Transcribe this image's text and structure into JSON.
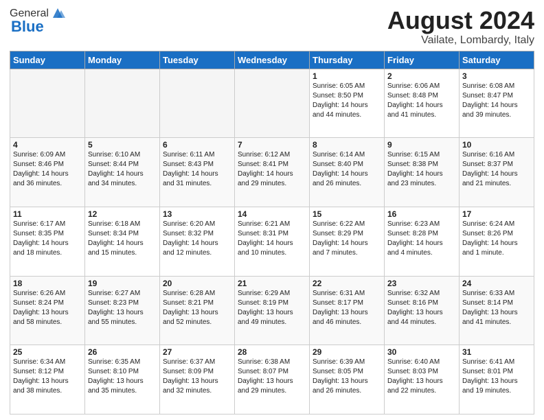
{
  "header": {
    "logo_general": "General",
    "logo_blue": "Blue",
    "month_year": "August 2024",
    "location": "Vailate, Lombardy, Italy"
  },
  "days_of_week": [
    "Sunday",
    "Monday",
    "Tuesday",
    "Wednesday",
    "Thursday",
    "Friday",
    "Saturday"
  ],
  "weeks": [
    [
      {
        "day": "",
        "info": ""
      },
      {
        "day": "",
        "info": ""
      },
      {
        "day": "",
        "info": ""
      },
      {
        "day": "",
        "info": ""
      },
      {
        "day": "1",
        "info": "Sunrise: 6:05 AM\nSunset: 8:50 PM\nDaylight: 14 hours\nand 44 minutes."
      },
      {
        "day": "2",
        "info": "Sunrise: 6:06 AM\nSunset: 8:48 PM\nDaylight: 14 hours\nand 41 minutes."
      },
      {
        "day": "3",
        "info": "Sunrise: 6:08 AM\nSunset: 8:47 PM\nDaylight: 14 hours\nand 39 minutes."
      }
    ],
    [
      {
        "day": "4",
        "info": "Sunrise: 6:09 AM\nSunset: 8:46 PM\nDaylight: 14 hours\nand 36 minutes."
      },
      {
        "day": "5",
        "info": "Sunrise: 6:10 AM\nSunset: 8:44 PM\nDaylight: 14 hours\nand 34 minutes."
      },
      {
        "day": "6",
        "info": "Sunrise: 6:11 AM\nSunset: 8:43 PM\nDaylight: 14 hours\nand 31 minutes."
      },
      {
        "day": "7",
        "info": "Sunrise: 6:12 AM\nSunset: 8:41 PM\nDaylight: 14 hours\nand 29 minutes."
      },
      {
        "day": "8",
        "info": "Sunrise: 6:14 AM\nSunset: 8:40 PM\nDaylight: 14 hours\nand 26 minutes."
      },
      {
        "day": "9",
        "info": "Sunrise: 6:15 AM\nSunset: 8:38 PM\nDaylight: 14 hours\nand 23 minutes."
      },
      {
        "day": "10",
        "info": "Sunrise: 6:16 AM\nSunset: 8:37 PM\nDaylight: 14 hours\nand 21 minutes."
      }
    ],
    [
      {
        "day": "11",
        "info": "Sunrise: 6:17 AM\nSunset: 8:35 PM\nDaylight: 14 hours\nand 18 minutes."
      },
      {
        "day": "12",
        "info": "Sunrise: 6:18 AM\nSunset: 8:34 PM\nDaylight: 14 hours\nand 15 minutes."
      },
      {
        "day": "13",
        "info": "Sunrise: 6:20 AM\nSunset: 8:32 PM\nDaylight: 14 hours\nand 12 minutes."
      },
      {
        "day": "14",
        "info": "Sunrise: 6:21 AM\nSunset: 8:31 PM\nDaylight: 14 hours\nand 10 minutes."
      },
      {
        "day": "15",
        "info": "Sunrise: 6:22 AM\nSunset: 8:29 PM\nDaylight: 14 hours\nand 7 minutes."
      },
      {
        "day": "16",
        "info": "Sunrise: 6:23 AM\nSunset: 8:28 PM\nDaylight: 14 hours\nand 4 minutes."
      },
      {
        "day": "17",
        "info": "Sunrise: 6:24 AM\nSunset: 8:26 PM\nDaylight: 14 hours\nand 1 minute."
      }
    ],
    [
      {
        "day": "18",
        "info": "Sunrise: 6:26 AM\nSunset: 8:24 PM\nDaylight: 13 hours\nand 58 minutes."
      },
      {
        "day": "19",
        "info": "Sunrise: 6:27 AM\nSunset: 8:23 PM\nDaylight: 13 hours\nand 55 minutes."
      },
      {
        "day": "20",
        "info": "Sunrise: 6:28 AM\nSunset: 8:21 PM\nDaylight: 13 hours\nand 52 minutes."
      },
      {
        "day": "21",
        "info": "Sunrise: 6:29 AM\nSunset: 8:19 PM\nDaylight: 13 hours\nand 49 minutes."
      },
      {
        "day": "22",
        "info": "Sunrise: 6:31 AM\nSunset: 8:17 PM\nDaylight: 13 hours\nand 46 minutes."
      },
      {
        "day": "23",
        "info": "Sunrise: 6:32 AM\nSunset: 8:16 PM\nDaylight: 13 hours\nand 44 minutes."
      },
      {
        "day": "24",
        "info": "Sunrise: 6:33 AM\nSunset: 8:14 PM\nDaylight: 13 hours\nand 41 minutes."
      }
    ],
    [
      {
        "day": "25",
        "info": "Sunrise: 6:34 AM\nSunset: 8:12 PM\nDaylight: 13 hours\nand 38 minutes."
      },
      {
        "day": "26",
        "info": "Sunrise: 6:35 AM\nSunset: 8:10 PM\nDaylight: 13 hours\nand 35 minutes."
      },
      {
        "day": "27",
        "info": "Sunrise: 6:37 AM\nSunset: 8:09 PM\nDaylight: 13 hours\nand 32 minutes."
      },
      {
        "day": "28",
        "info": "Sunrise: 6:38 AM\nSunset: 8:07 PM\nDaylight: 13 hours\nand 29 minutes."
      },
      {
        "day": "29",
        "info": "Sunrise: 6:39 AM\nSunset: 8:05 PM\nDaylight: 13 hours\nand 26 minutes."
      },
      {
        "day": "30",
        "info": "Sunrise: 6:40 AM\nSunset: 8:03 PM\nDaylight: 13 hours\nand 22 minutes."
      },
      {
        "day": "31",
        "info": "Sunrise: 6:41 AM\nSunset: 8:01 PM\nDaylight: 13 hours\nand 19 minutes."
      }
    ]
  ]
}
